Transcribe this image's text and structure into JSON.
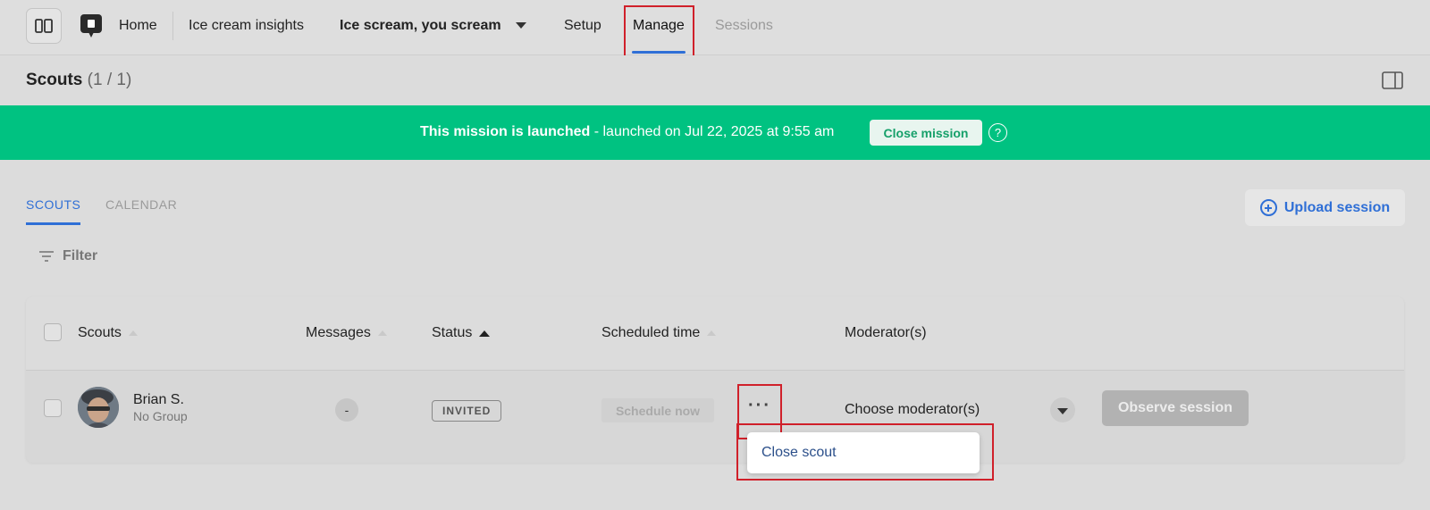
{
  "nav": {
    "home": "Home",
    "breadcrumb": "Ice cream insights",
    "mission": "Ice scream, you scream",
    "tabs": {
      "setup": "Setup",
      "manage": "Manage",
      "sessions": "Sessions"
    }
  },
  "page": {
    "title": "Scouts",
    "count": "(1 / 1)"
  },
  "banner": {
    "strong": "This mission is launched",
    "rest": " - launched on Jul 22, 2025 at 9:55 am",
    "close_label": "Close mission",
    "help": "?"
  },
  "tabs": {
    "scouts": "SCOUTS",
    "calendar": "CALENDAR"
  },
  "upload_label": "Upload session",
  "filter_label": "Filter",
  "table": {
    "columns": {
      "scouts": "Scouts",
      "messages": "Messages",
      "status": "Status",
      "scheduled": "Scheduled time",
      "moderators": "Moderator(s)"
    },
    "rows": [
      {
        "name": "Brian S.",
        "group": "No Group",
        "messages": "-",
        "status": "INVITED",
        "schedule_label": "Schedule now",
        "more": "···",
        "moderator": "Choose moderator(s)",
        "observe_label": "Observe session"
      }
    ]
  },
  "menu": {
    "close_scout": "Close scout"
  },
  "colors": {
    "accent": "#2f6fd6",
    "banner": "#00c281",
    "highlight": "#d0202a"
  }
}
